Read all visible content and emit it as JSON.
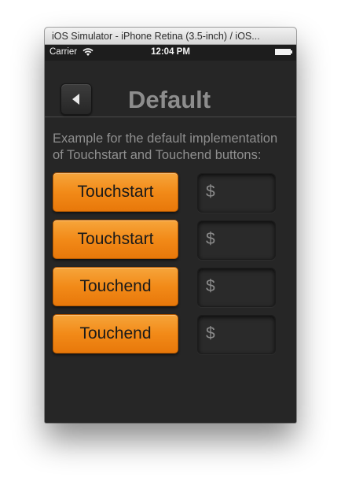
{
  "window": {
    "title": "iOS Simulator - iPhone Retina (3.5-inch) / iOS..."
  },
  "status_bar": {
    "carrier": "Carrier",
    "time": "12:04 PM",
    "wifi_icon": "wifi-icon",
    "battery_icon": "battery-icon"
  },
  "nav": {
    "back_icon": "back-arrow-icon",
    "title": "Default"
  },
  "description": "Example for the default implementation of Touchstart and Touchend buttons:",
  "rows": [
    {
      "button_label": "Touchstart",
      "value": "$"
    },
    {
      "button_label": "Touchstart",
      "value": "$"
    },
    {
      "button_label": "Touchend",
      "value": "$"
    },
    {
      "button_label": "Touchend",
      "value": "$"
    }
  ],
  "colors": {
    "accent": "#f28a18",
    "background": "#262626",
    "title_text": "#8d8d8d"
  }
}
